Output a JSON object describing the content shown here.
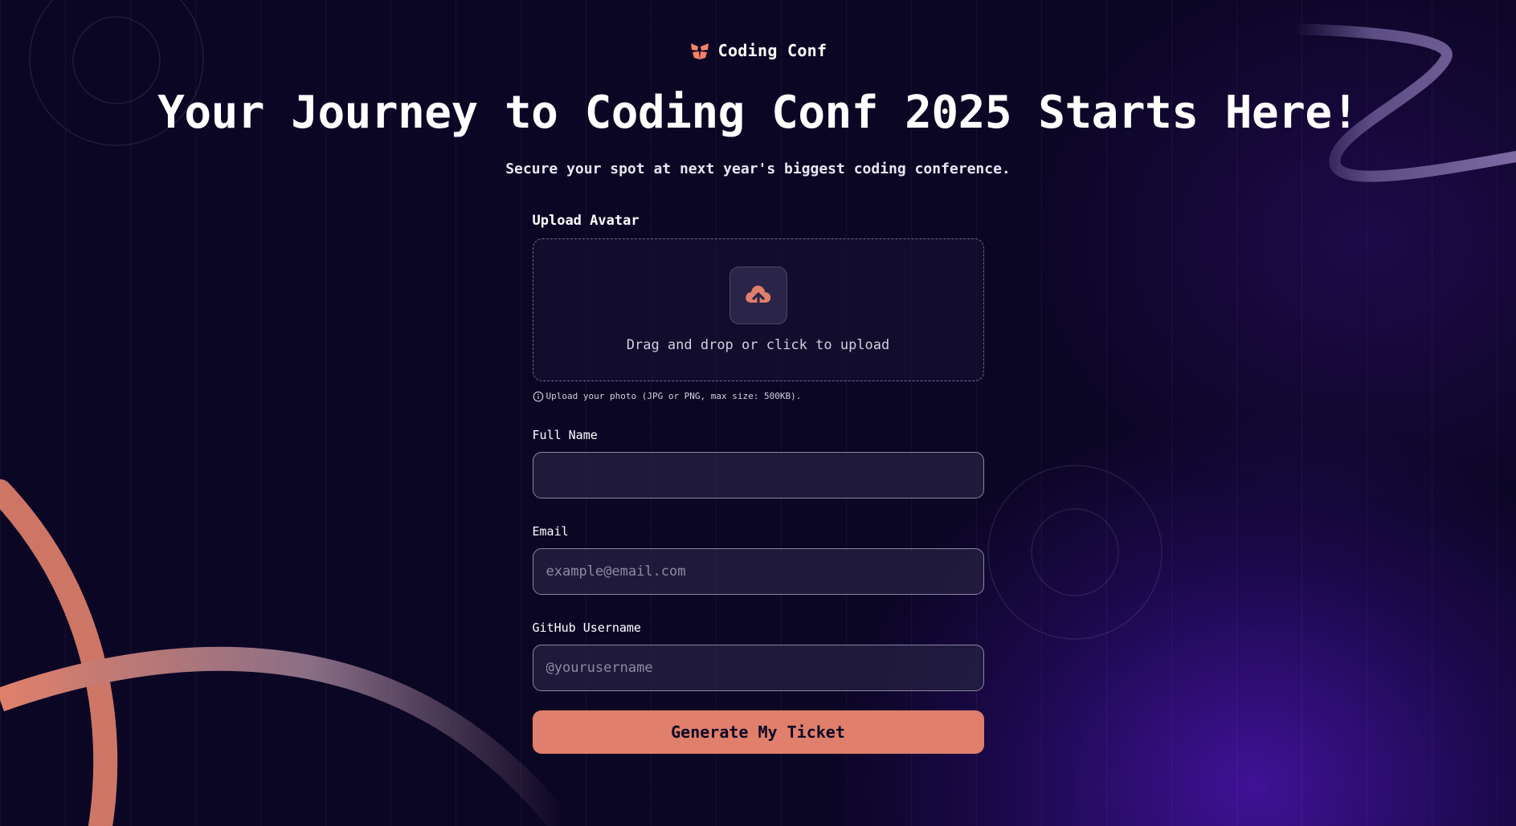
{
  "brand": {
    "name": "Coding Conf",
    "logo_icon": "coding-conf-logo-icon"
  },
  "hero": {
    "title": "Your Journey to Coding Conf 2025 Starts Here!",
    "subtitle": "Secure your spot at next year's biggest coding conference."
  },
  "form": {
    "avatar": {
      "label": "Upload Avatar",
      "dropzone_text": "Drag and drop or click to upload",
      "icon": "cloud-upload-icon",
      "hint_icon": "info-icon",
      "hint": "Upload your photo (JPG or PNG, max size: 500KB)."
    },
    "full_name": {
      "label": "Full Name",
      "value": "",
      "placeholder": ""
    },
    "email": {
      "label": "Email",
      "value": "",
      "placeholder": "example@email.com"
    },
    "github": {
      "label": "GitHub Username",
      "value": "",
      "placeholder": "@yourusername"
    },
    "submit_label": "Generate My Ticket"
  },
  "colors": {
    "background": "#0c0625",
    "accent": "#e07f6b",
    "input_background": "#262142",
    "input_border": "#8a86a3"
  }
}
